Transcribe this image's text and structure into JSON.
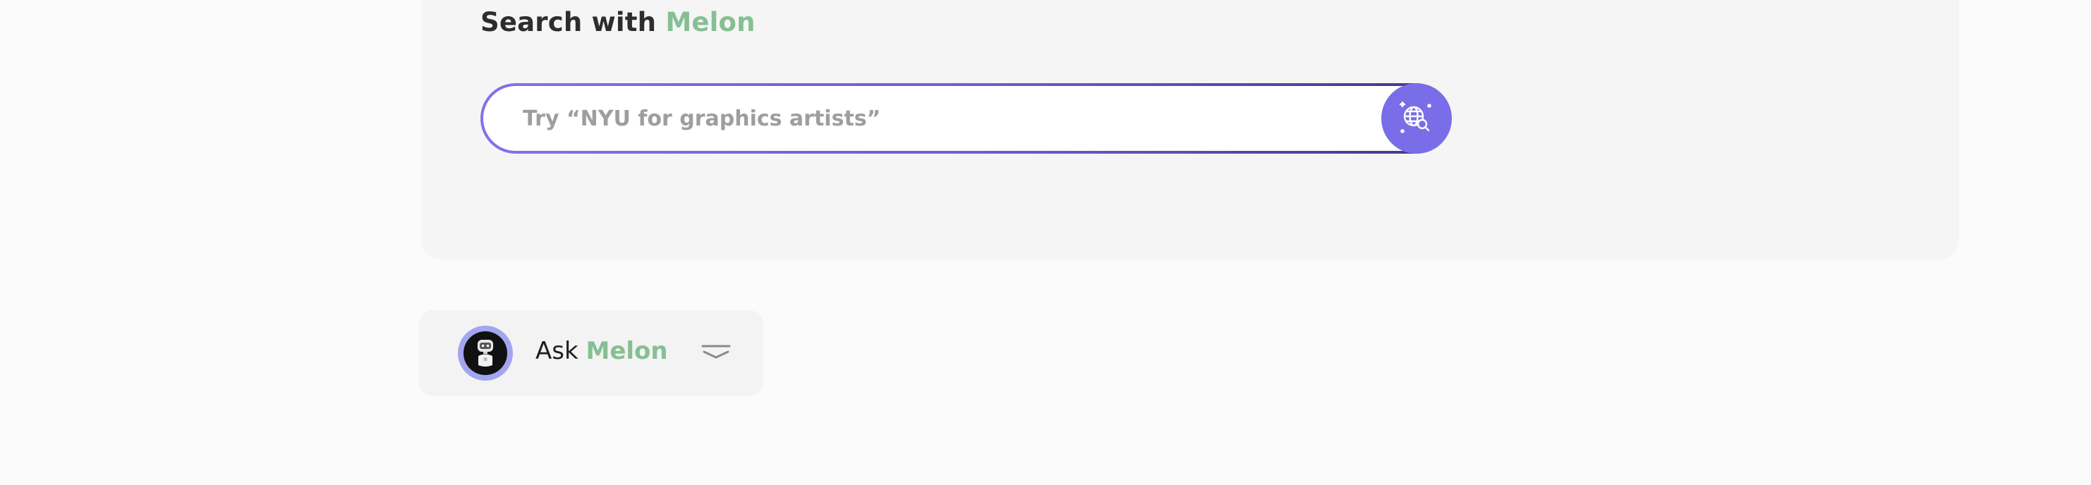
{
  "search": {
    "title_prefix": "Search with",
    "title_brand": "Melon",
    "placeholder": "Try “NYU for graphics artists”",
    "value": "",
    "button_icon": "globe-search-icon"
  },
  "ask": {
    "label_prefix": "Ask",
    "label_brand": "Melon",
    "avatar_icon": "robot-avatar",
    "toggle_icon": "chevron-down-icon"
  },
  "colors": {
    "brand_green": "#86bf93",
    "accent_purple": "#7a6de8",
    "panel_bg": "#f5f5f5",
    "page_bg": "#fbfbfb"
  }
}
